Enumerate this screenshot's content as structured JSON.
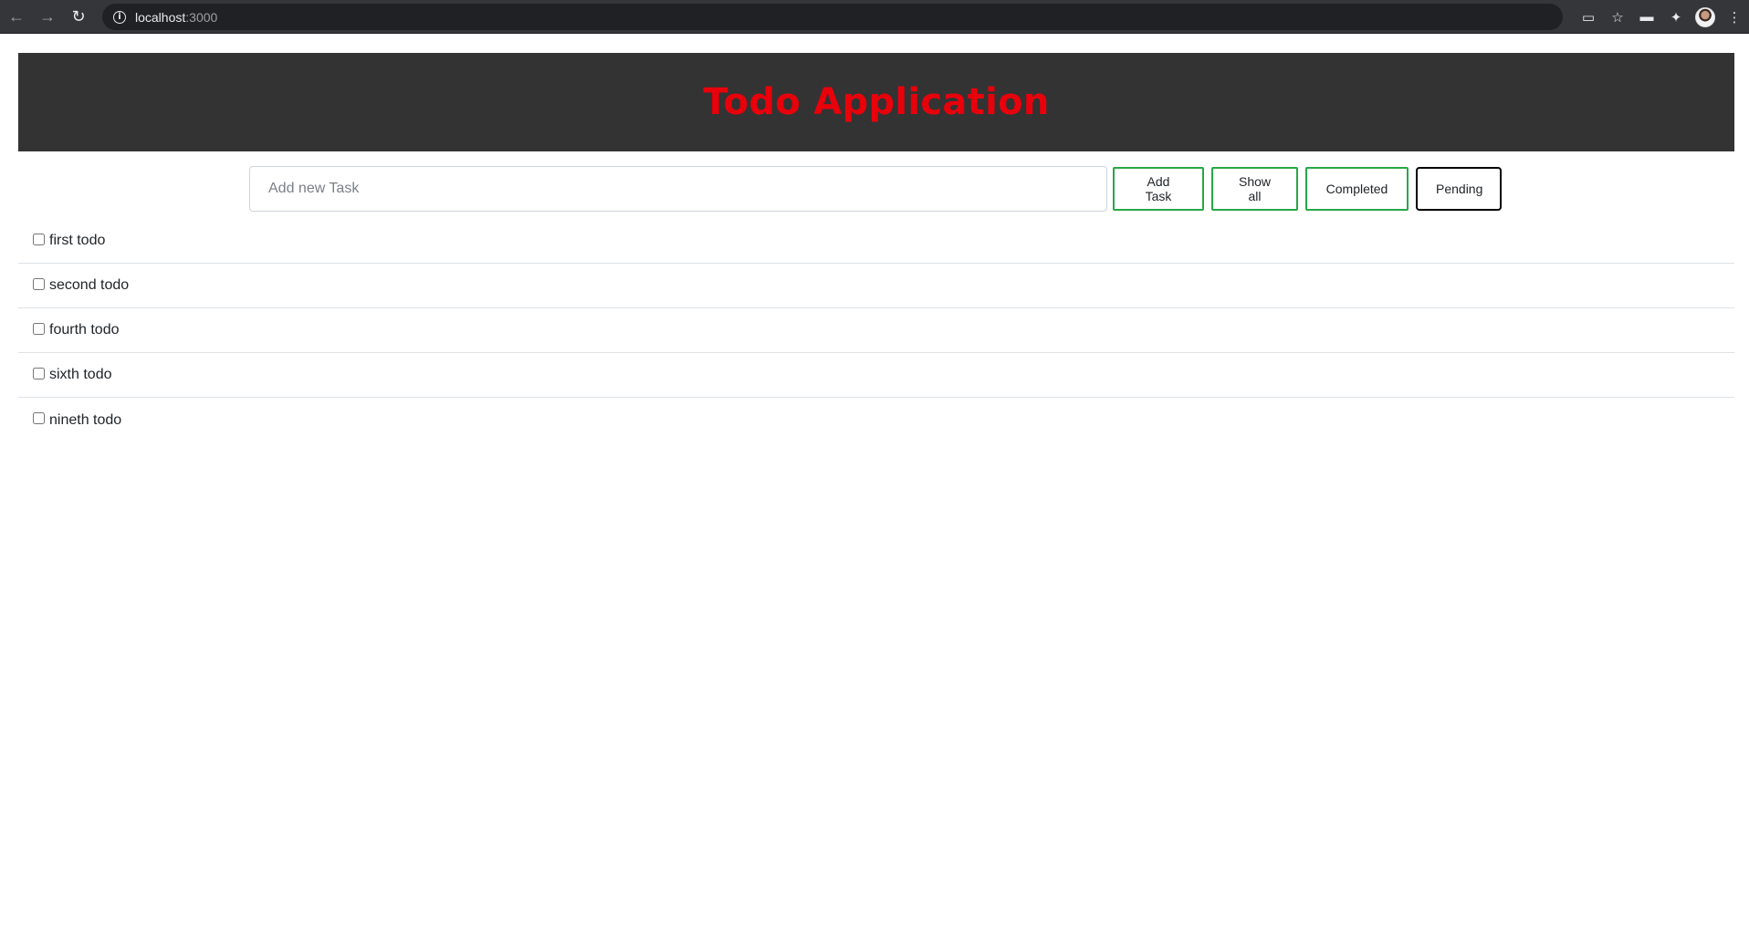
{
  "browser": {
    "url_host": "localhost",
    "url_port": ":3000"
  },
  "app": {
    "title": "Todo Application"
  },
  "controls": {
    "input_placeholder": "Add new Task",
    "input_value": "",
    "add_label": "Add Task",
    "show_all_label": "Show all",
    "completed_label": "Completed",
    "pending_label": "Pending",
    "active_filter": "Pending"
  },
  "todos": [
    {
      "text": "first todo",
      "checked": false
    },
    {
      "text": "second todo",
      "checked": false
    },
    {
      "text": "fourth todo",
      "checked": false
    },
    {
      "text": "sixth todo",
      "checked": false
    },
    {
      "text": "nineth todo",
      "checked": false
    }
  ],
  "colors": {
    "title": "#e8000b",
    "header_bg": "#333333",
    "button_border": "#28a745",
    "active_button_border": "#000000"
  }
}
